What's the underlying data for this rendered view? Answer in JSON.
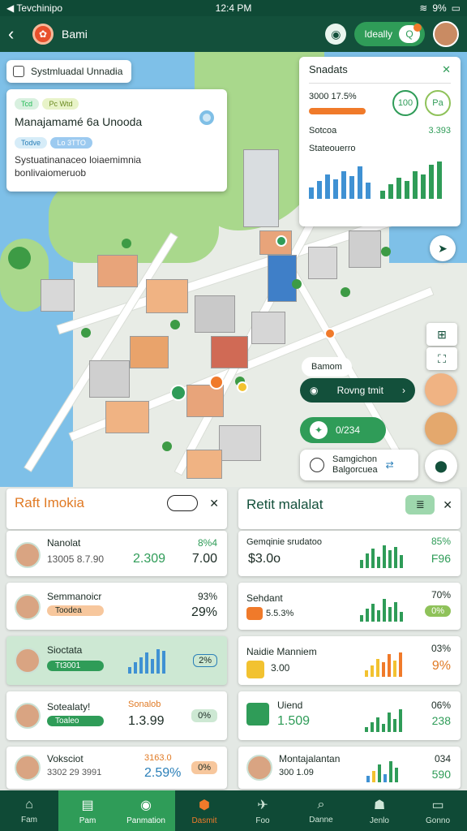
{
  "status": {
    "left": "◀ Tevchinipo",
    "time": "12:4 PM",
    "battery": "9%"
  },
  "header": {
    "title": "Bami",
    "action_label": "Ideally"
  },
  "search": {
    "label": "Systmluadal Unnadia"
  },
  "info_card": {
    "chip1": "Tcd",
    "chip2": "Pc Wtd",
    "title": "Manajamamé 6a Unooda",
    "chip3": "Todve",
    "chip4": "Lo 3TTO",
    "detail": "Systuatinanaceo loiaemimnia",
    "detail2": "bonlivaiomeruob"
  },
  "stats_card": {
    "title": "Snadats",
    "row1": "3000 17.5%",
    "badge1": "100",
    "badge2": "Pa",
    "row2": "Sotcoa",
    "value2": "3.393",
    "row3": "Stateouerro"
  },
  "route": {
    "chip": "Bamom",
    "nav": "Rovng tmit",
    "pct": "0/234",
    "place": "Samgichon",
    "place_sub": "Balgorcuea"
  },
  "left_panel": {
    "title": "Raft Imokia",
    "rows": [
      {
        "name": "Nanolat",
        "sub": "13005 8.7.90",
        "value": "2.309",
        "right1": "8%4",
        "right2": "7.00"
      },
      {
        "name": "Semmanoicr",
        "sub": "Toodea",
        "value": "",
        "right1": "93%",
        "right2": "29%"
      },
      {
        "name": "Sioctata",
        "sub": "Tt3001",
        "value": "",
        "right1": "",
        "right2": "2%"
      },
      {
        "name": "Sotealaty!",
        "sub": "Toaleo",
        "value": "1.3.99",
        "right1": "Sonalob",
        "right2": "0%"
      },
      {
        "name": "Voksciot",
        "sub": "3302 29 3991",
        "value": "2.59%",
        "right1": "3163.0",
        "right2": "0%"
      }
    ]
  },
  "right_panel": {
    "title": "Retit malalat",
    "rows": [
      {
        "name": "Gemqinie srudatoo",
        "value": "$3.0o",
        "right1": "85%",
        "right2": "F96"
      },
      {
        "name": "Sehdant",
        "value": "5.5.3%",
        "right1": "70%",
        "right2": "0%"
      },
      {
        "name": "Naidie Manniem",
        "value": "3.00",
        "right1": "03%",
        "right2": "9%"
      },
      {
        "name": "Uiend",
        "value": "1.509",
        "right1": "06%",
        "right2": "238"
      },
      {
        "name": "Montajalantan",
        "value": "300 1.09",
        "right1": "034",
        "right2": "590"
      }
    ]
  },
  "tabs": [
    {
      "label": "Fam",
      "icon": "home-icon",
      "active": false
    },
    {
      "label": "Pam",
      "icon": "list-icon",
      "active": true
    },
    {
      "label": "Panmation",
      "icon": "pin-icon",
      "active": true
    },
    {
      "label": "Dasmit",
      "icon": "orange-icon",
      "active": false
    },
    {
      "label": "Foo",
      "icon": "chart-icon",
      "active": false
    },
    {
      "label": "Danne",
      "icon": "search-icon",
      "active": false
    },
    {
      "label": "Jenlo",
      "icon": "person-icon",
      "active": false
    },
    {
      "label": "Gonno",
      "icon": "monitor-icon",
      "active": false
    }
  ],
  "colors": {
    "primary": "#13503b",
    "accent": "#2f9c58",
    "orange": "#f07a2a"
  }
}
